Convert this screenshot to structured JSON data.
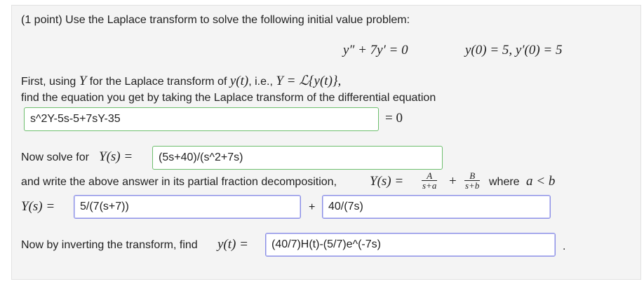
{
  "problem": {
    "intro": "(1 point) Use the Laplace transform to solve the following initial value problem:",
    "ode": "y″ + 7y′ = 0",
    "initial_conditions": "y(0) = 5,  y′(0) = 5"
  },
  "step1": {
    "line1_prefix": "First, using",
    "line1_Y": "Y",
    "line1_mid": "for the Laplace transform of",
    "line1_yt": "y(t)",
    "line1_ie": ", i.e.,",
    "line1_def": "Y = ℒ{y(t)},",
    "line2": "find the equation you get by taking the Laplace transform of the differential equation",
    "answer": "s^2Y-5s-5+7sY-35",
    "eq_suffix": "= 0"
  },
  "step2": {
    "prefix": "Now solve for",
    "Ys": "Y(s) =",
    "answer": "(5s+40)/(s^2+7s)"
  },
  "step3": {
    "text": "and write the above answer in its partial fraction decomposition,",
    "Ys_eq": "Y(s) =",
    "frac_A_num": "A",
    "frac_A_den": "s+a",
    "plus": "+",
    "frac_B_num": "B",
    "frac_B_den": "s+b",
    "where": "where",
    "cond": "a < b",
    "lhs": "Y(s) =",
    "answer_A": "5/(7(s+7))",
    "plus_between": "+",
    "answer_B": "40/(7s)"
  },
  "step4": {
    "prefix": "Now by inverting the transform, find",
    "yt": "y(t) =",
    "answer": "(40/7)H(t)-(5/7)e^(-7s)",
    "period": "."
  }
}
